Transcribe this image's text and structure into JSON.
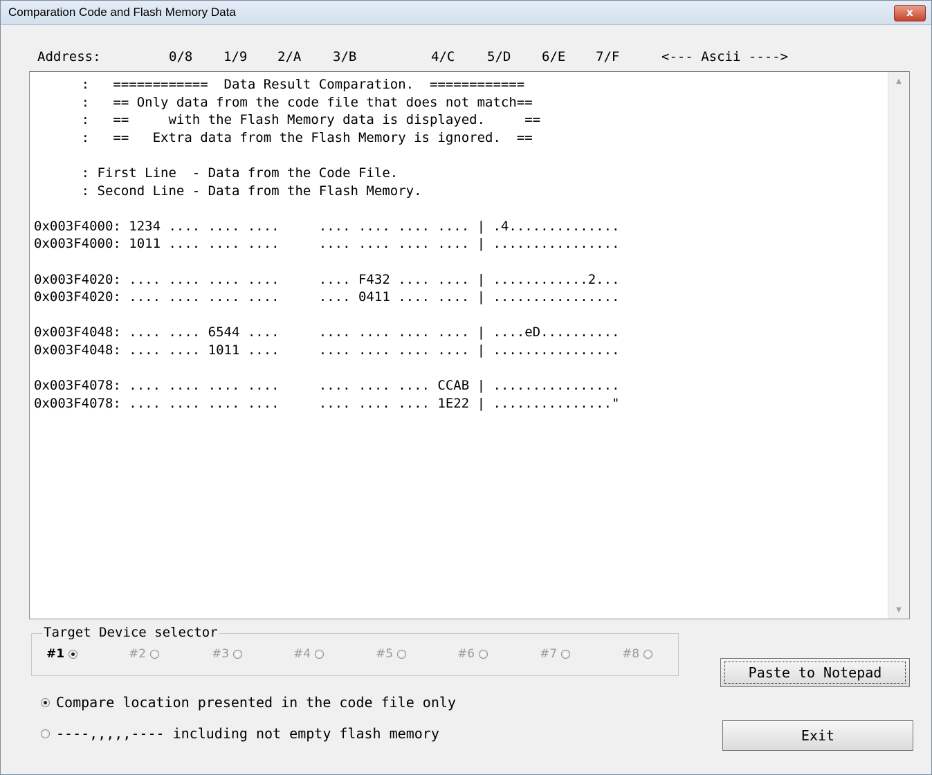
{
  "window": {
    "title": "Comparation Code and Flash Memory Data",
    "close_glyph": "x"
  },
  "header": {
    "address_label": "Address:",
    "columns": [
      "0/8",
      "1/9",
      "2/A",
      "3/B",
      "4/C",
      "5/D",
      "6/E",
      "7/F"
    ],
    "ascii_label": "<--- Ascii ---->"
  },
  "output_lines": [
    "      :   ============  Data Result Comparation.  ============",
    "      :   == Only data from the code file that does not match==",
    "      :   ==     with the Flash Memory data is displayed.     ==",
    "      :   ==   Extra data from the Flash Memory is ignored.  ==",
    "",
    "      : First Line  - Data from the Code File.",
    "      : Second Line - Data from the Flash Memory.",
    "",
    "0x003F4000: 1234 .... .... ....     .... .... .... .... | .4..............",
    "0x003F4000: 1011 .... .... ....     .... .... .... .... | ................",
    "",
    "0x003F4020: .... .... .... ....     .... F432 .... .... | ............2...",
    "0x003F4020: .... .... .... ....     .... 0411 .... .... | ................",
    "",
    "0x003F4048: .... .... 6544 ....     .... .... .... .... | ....eD..........",
    "0x003F4048: .... .... 1011 ....     .... .... .... .... | ................",
    "",
    "0x003F4078: .... .... .... ....     .... .... .... CCAB | ................",
    "0x003F4078: .... .... .... ....     .... .... .... 1E22 | ...............\""
  ],
  "target_selector": {
    "label": "Target Device selector",
    "devices": [
      "#1",
      "#2",
      "#3",
      "#4",
      "#5",
      "#6",
      "#7",
      "#8"
    ],
    "selected": "#1"
  },
  "options": {
    "compare_code_only": "Compare location presented in the code file only",
    "include_non_empty": "----,,,,,---- including not empty flash memory",
    "selected": "compare_code_only"
  },
  "buttons": {
    "paste": "Paste to Notepad",
    "exit": "Exit"
  }
}
